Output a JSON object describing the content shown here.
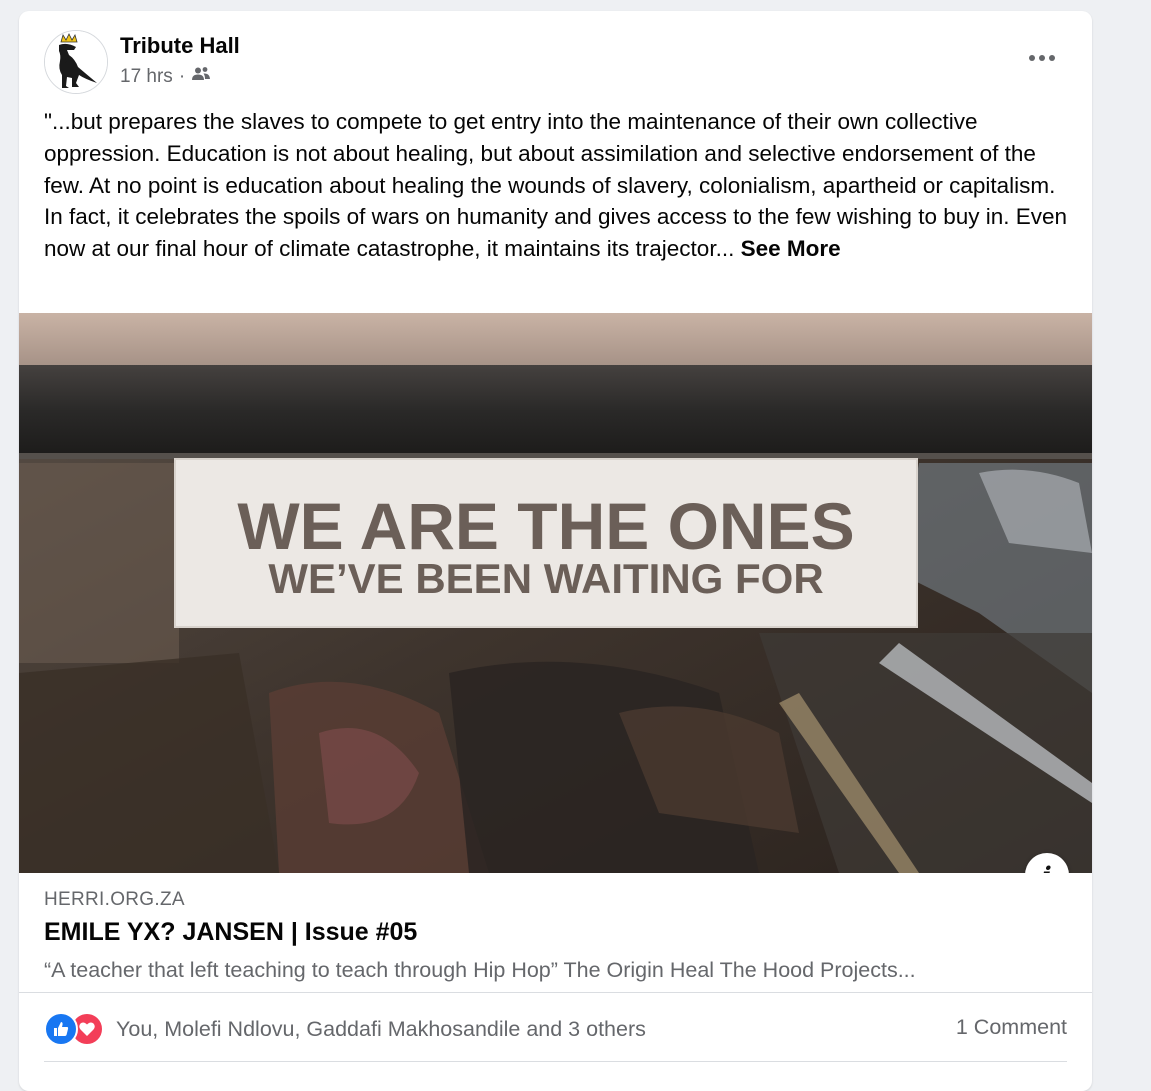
{
  "post": {
    "author": "Tribute Hall",
    "time": "17 hrs",
    "separator": "·",
    "audience_icon": "friends-icon",
    "more_icon": "more-options-icon",
    "text": "\"...but prepares the slaves to compete to get entry into the maintenance of their own collective oppression. Education is not about healing, but about assimilation and selective endorsement of the few. At no point is education about healing the wounds of slavery, colonialism, apartheid or capitalism. In fact, it celebrates the spoils of wars on humanity and gives access to the few wishing to buy in. Even now at our final hour of climate catastrophe, it maintains its trajector...",
    "see_more": "See More"
  },
  "image": {
    "sign_line1": "WE ARE THE ONES",
    "sign_line2": "WE’VE BEEN WAITING FOR",
    "info_glyph": "i"
  },
  "link": {
    "domain": "HERRI.ORG.ZA",
    "title": "EMILE YX? JANSEN | Issue #05",
    "description": "“A teacher that left teaching to teach through Hip Hop” The Origin Heal The Hood Projects..."
  },
  "footer": {
    "reactions": "You, Molefi Ndlovu, Gaddafi Makhosandile and 3 others",
    "comments": "1 Comment"
  },
  "colors": {
    "like": "#1877f2",
    "love": "#f33e58",
    "secondary_text": "#65676b",
    "sign_text": "#6b5f58",
    "sign_bg": "#ece8e4"
  }
}
